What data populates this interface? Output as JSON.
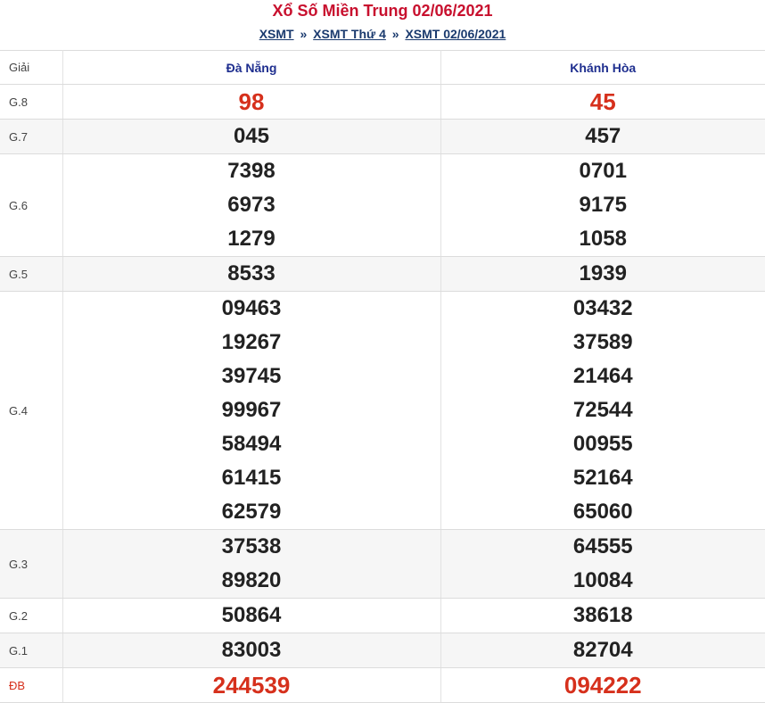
{
  "title": "Xổ Số Miền Trung 02/06/2021",
  "breadcrumb": {
    "items": [
      "XSMT",
      "XSMT Thứ 4",
      "XSMT 02/06/2021"
    ],
    "separator": "»"
  },
  "table": {
    "header": {
      "label": "Giải",
      "provinces": [
        "Đà Nẵng",
        "Khánh Hòa"
      ]
    },
    "rows": [
      {
        "prize": "G.8",
        "values": [
          [
            "98"
          ],
          [
            "45"
          ]
        ]
      },
      {
        "prize": "G.7",
        "values": [
          [
            "045"
          ],
          [
            "457"
          ]
        ]
      },
      {
        "prize": "G.6",
        "values": [
          [
            "7398",
            "6973",
            "1279"
          ],
          [
            "0701",
            "9175",
            "1058"
          ]
        ]
      },
      {
        "prize": "G.5",
        "values": [
          [
            "8533"
          ],
          [
            "1939"
          ]
        ]
      },
      {
        "prize": "G.4",
        "values": [
          [
            "09463",
            "19267",
            "39745",
            "99967",
            "58494",
            "61415",
            "62579"
          ],
          [
            "03432",
            "37589",
            "21464",
            "72544",
            "00955",
            "52164",
            "65060"
          ]
        ]
      },
      {
        "prize": "G.3",
        "values": [
          [
            "37538",
            "89820"
          ],
          [
            "64555",
            "10084"
          ]
        ]
      },
      {
        "prize": "G.2",
        "values": [
          [
            "50864"
          ],
          [
            "38618"
          ]
        ]
      },
      {
        "prize": "G.1",
        "values": [
          [
            "83003"
          ],
          [
            "82704"
          ]
        ]
      },
      {
        "prize": "ĐB",
        "values": [
          [
            "244539"
          ],
          [
            "094222"
          ]
        ]
      }
    ]
  },
  "colors": {
    "title": "#c8102e",
    "highlight": "#d6301c",
    "header_text": "#1f2f8f",
    "breadcrumb": "#1a3a6e"
  }
}
